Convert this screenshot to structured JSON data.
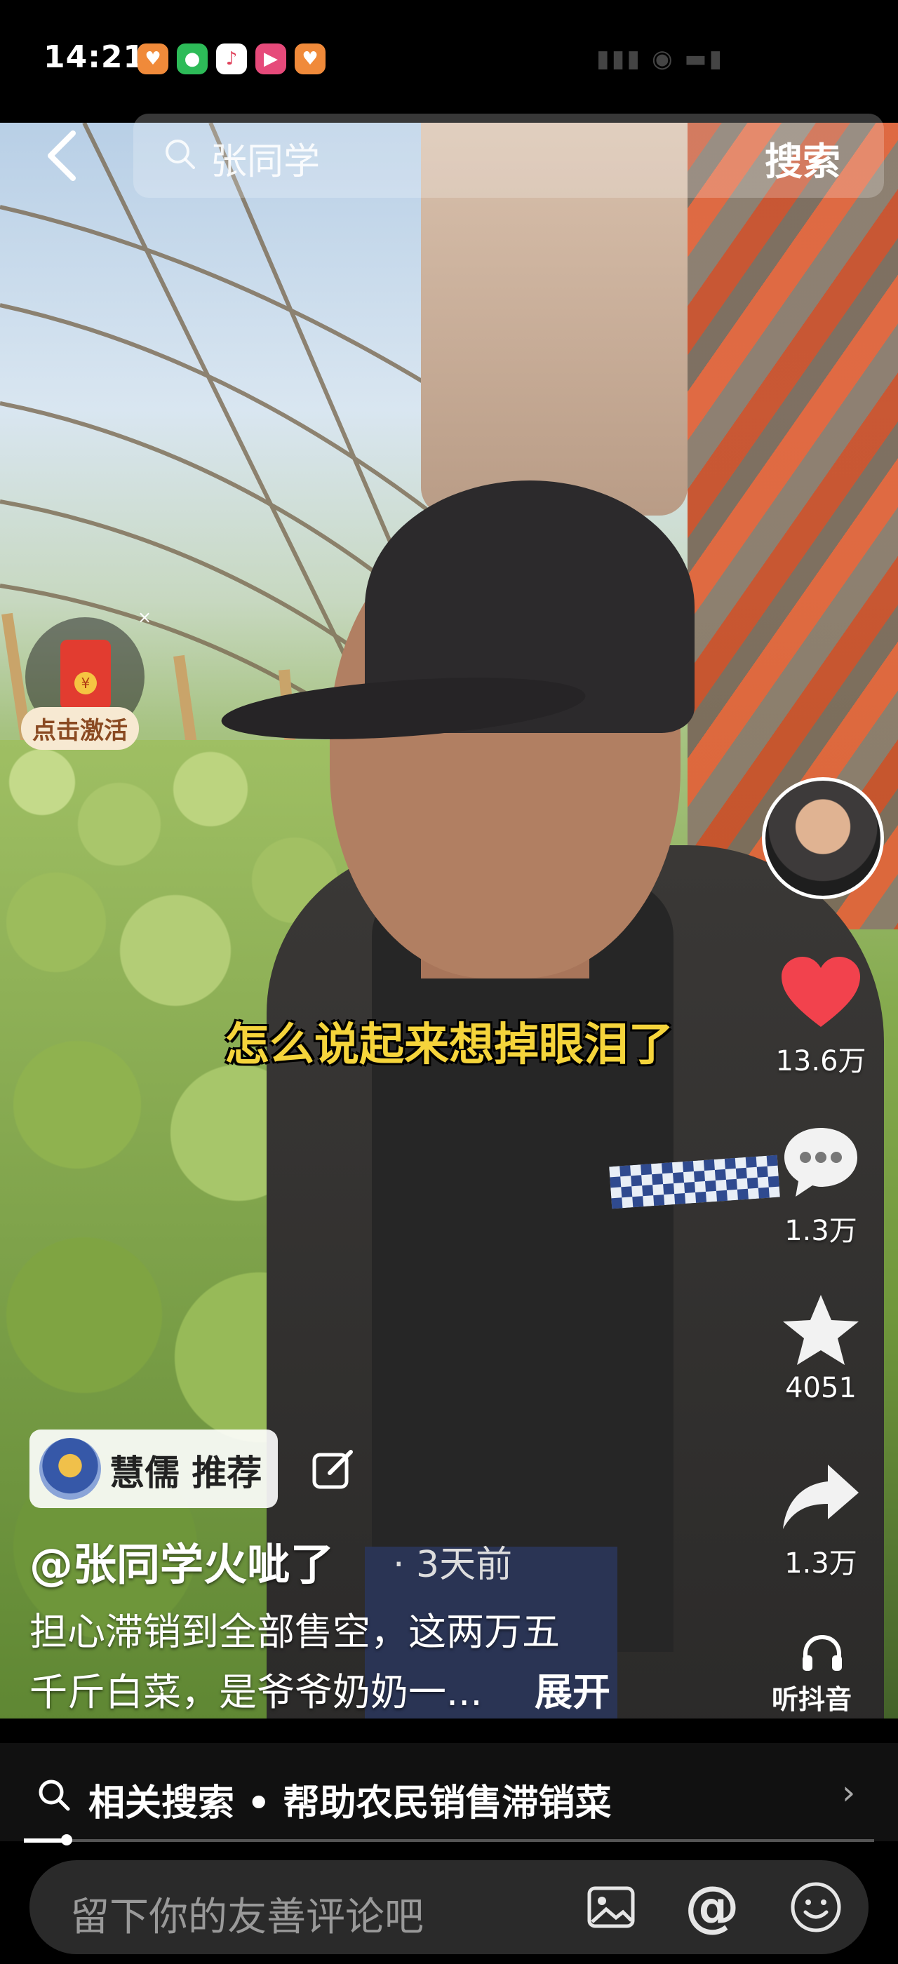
{
  "status_bar": {
    "time": "14:21",
    "app_icons": [
      "heart-app-icon",
      "wechat-icon",
      "music-icon",
      "video-icon",
      "heart-app-icon"
    ]
  },
  "top_bar": {
    "search_query": "张同学",
    "search_button": "搜索"
  },
  "red_packet": {
    "label": "点击激活",
    "close": "×"
  },
  "video": {
    "caption": "怎么说起来想掉眼泪了"
  },
  "actions": {
    "like_count": "13.6万",
    "comment_count": "1.3万",
    "favorite_count": "4051",
    "share_count": "1.3万",
    "listen_label": "听抖音"
  },
  "recommend": {
    "label": "慧儒 推荐"
  },
  "post": {
    "author": "@张同学火呲了",
    "time": "· 3天前",
    "description_line1": "担心滞销到全部售空，这两万五",
    "description_line2": "千斤白菜，是爷爷奶奶一...",
    "expand": "展开"
  },
  "related_search": {
    "text": "相关搜索 • 帮助农民销售滞销菜"
  },
  "progress": {
    "fraction": 0.05
  },
  "comment_bar": {
    "placeholder": "留下你的友善评论吧"
  },
  "colors": {
    "like_red": "#f2424d",
    "caption_yellow": "#f5d43b"
  }
}
